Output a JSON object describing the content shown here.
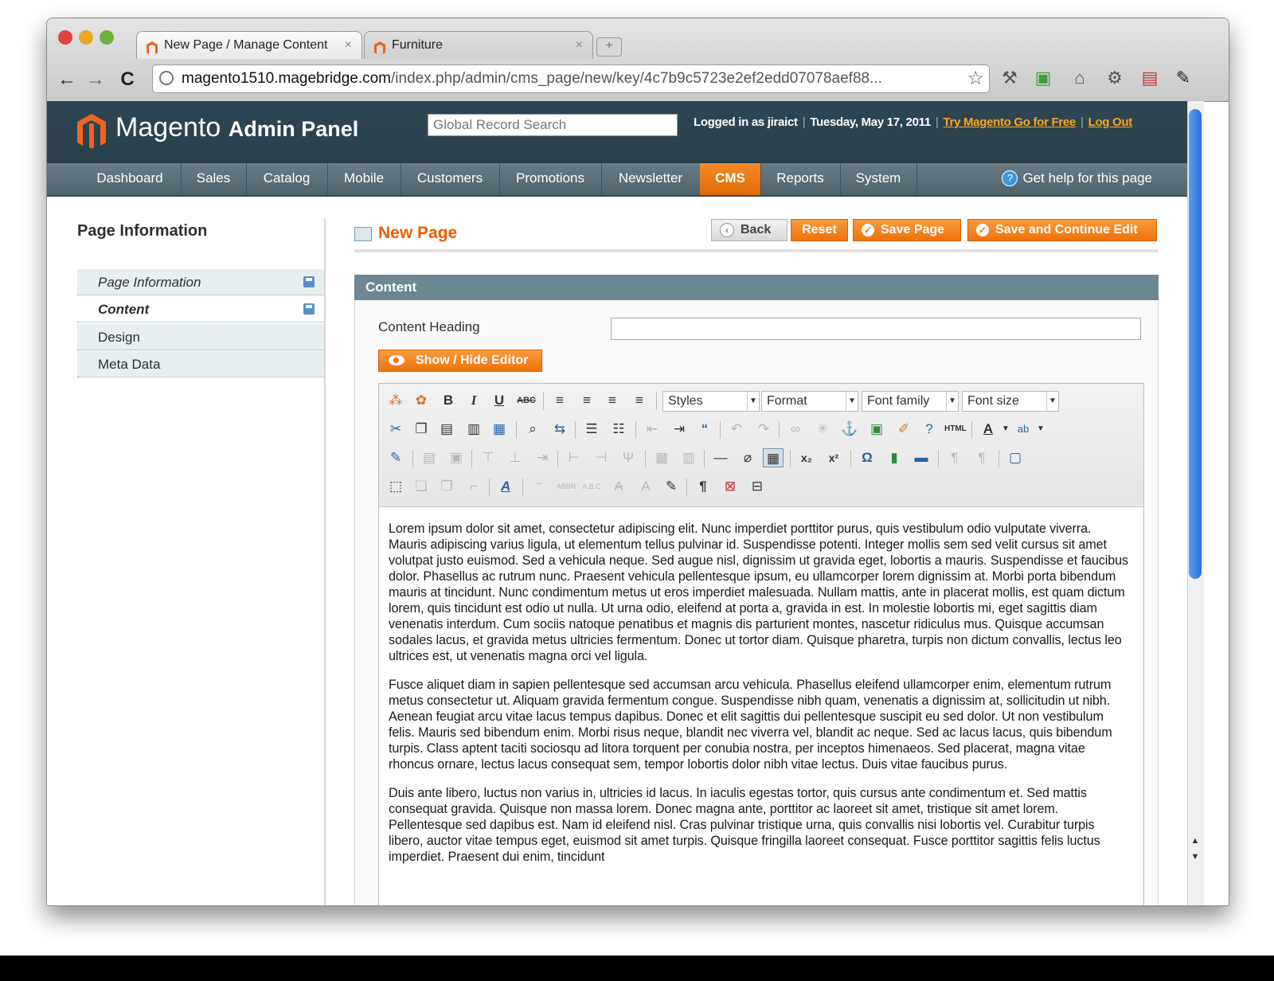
{
  "browser": {
    "tabs": [
      {
        "title": "New Page / Manage Content",
        "close": "×"
      },
      {
        "title": "Furniture",
        "close": "×"
      }
    ],
    "new_tab": "+",
    "nav": {
      "back": "←",
      "forward": "→",
      "reload": "C"
    },
    "url_host": "magento1510.magebridge.com",
    "url_path": "/index.php/admin/cms_page/new/key/4c7b9c5723e2ef2edd07078aef88...",
    "bookmark": "☆"
  },
  "header": {
    "logo_main": "Magento",
    "logo_sub": "Admin Panel",
    "search_placeholder": "Global Record Search",
    "logged_in": "Logged in as jiraict",
    "date": "Tuesday, May 17, 2011",
    "try_link": "Try Magento Go for Free",
    "logout": "Log Out",
    "sep": "|"
  },
  "nav": {
    "items": [
      "Dashboard",
      "Sales",
      "Catalog",
      "Mobile",
      "Customers",
      "Promotions",
      "Newsletter",
      "CMS",
      "Reports",
      "System"
    ],
    "active": "CMS",
    "help": "Get help for this page"
  },
  "sidebar": {
    "title": "Page Information",
    "items": [
      "Page Information",
      "Content",
      "Design",
      "Meta Data"
    ]
  },
  "page": {
    "title": "New Page",
    "buttons": {
      "back": "Back",
      "reset": "Reset",
      "save": "Save Page",
      "save_continue": "Save and Continue Edit"
    }
  },
  "content": {
    "section_title": "Content",
    "heading_label": "Content Heading",
    "heading_value": "",
    "toggle_editor": "Show / Hide Editor"
  },
  "editor": {
    "dropdowns": [
      "Styles",
      "Format",
      "Font family",
      "Font size"
    ],
    "paragraphs": [
      "Lorem ipsum dolor sit amet, consectetur adipiscing elit. Nunc imperdiet porttitor purus, quis vestibulum odio vulputate viverra. Mauris adipiscing varius ligula, ut elementum tellus pulvinar id. Suspendisse potenti. Integer mollis sem sed velit cursus sit amet volutpat justo euismod. Sed a vehicula neque. Sed augue nisl, dignissim ut gravida eget, lobortis a mauris. Suspendisse et faucibus dolor. Phasellus ac rutrum nunc. Praesent vehicula pellentesque ipsum, eu ullamcorper lorem dignissim at. Morbi porta bibendum mauris at tincidunt. Nunc condimentum metus ut eros imperdiet malesuada. Nullam mattis, ante in placerat mollis, est quam dictum lorem, quis tincidunt est odio ut nulla. Ut urna odio, eleifend at porta a, gravida in est. In molestie lobortis mi, eget sagittis diam venenatis interdum. Cum sociis natoque penatibus et magnis dis parturient montes, nascetur ridiculus mus. Quisque accumsan sodales lacus, et gravida metus ultricies fermentum. Donec ut tortor diam. Quisque pharetra, turpis non dictum convallis, lectus leo ultrices est, ut venenatis magna orci vel ligula.",
      "Fusce aliquet diam in sapien pellentesque sed accumsan arcu vehicula. Phasellus eleifend ullamcorper enim, elementum rutrum metus consectetur ut. Aliquam gravida fermentum congue. Suspendisse nibh quam, venenatis a dignissim at, sollicitudin ut nibh. Aenean feugiat arcu vitae lacus tempus dapibus. Donec et elit sagittis dui pellentesque suscipit eu sed dolor. Ut non vestibulum felis. Mauris sed bibendum enim. Morbi risus neque, blandit nec viverra vel, blandit ac neque. Sed ac lacus lacus, quis bibendum turpis. Class aptent taciti sociosqu ad litora torquent per conubia nostra, per inceptos himenaeos. Sed placerat, magna vitae rhoncus ornare, lectus lacus consequat sem, tempor lobortis dolor nibh vitae lectus. Duis vitae faucibus purus.",
      "Duis ante libero, luctus non varius in, ultricies id lacus. In iaculis egestas tortor, quis cursus ante condimentum et. Sed mattis consequat gravida. Quisque non massa lorem. Donec magna ante, porttitor ac laoreet sit amet, tristique sit amet lorem. Pellentesque sed dapibus est. Nam id eleifend nisl. Cras pulvinar tristique urna, quis convallis nisi lobortis vel. Curabitur turpis libero, auctor vitae tempus eget, euismod sit amet turpis. Quisque fringilla laoreet consequat. Fusce porttitor sagittis felis luctus imperdiet. Praesent dui enim, tincidunt"
    ]
  },
  "colors": {
    "accent": "#eb5e00",
    "header_bg": "#2e4753",
    "nav_bg": "#5d7079",
    "section_bg": "#6d8892"
  }
}
